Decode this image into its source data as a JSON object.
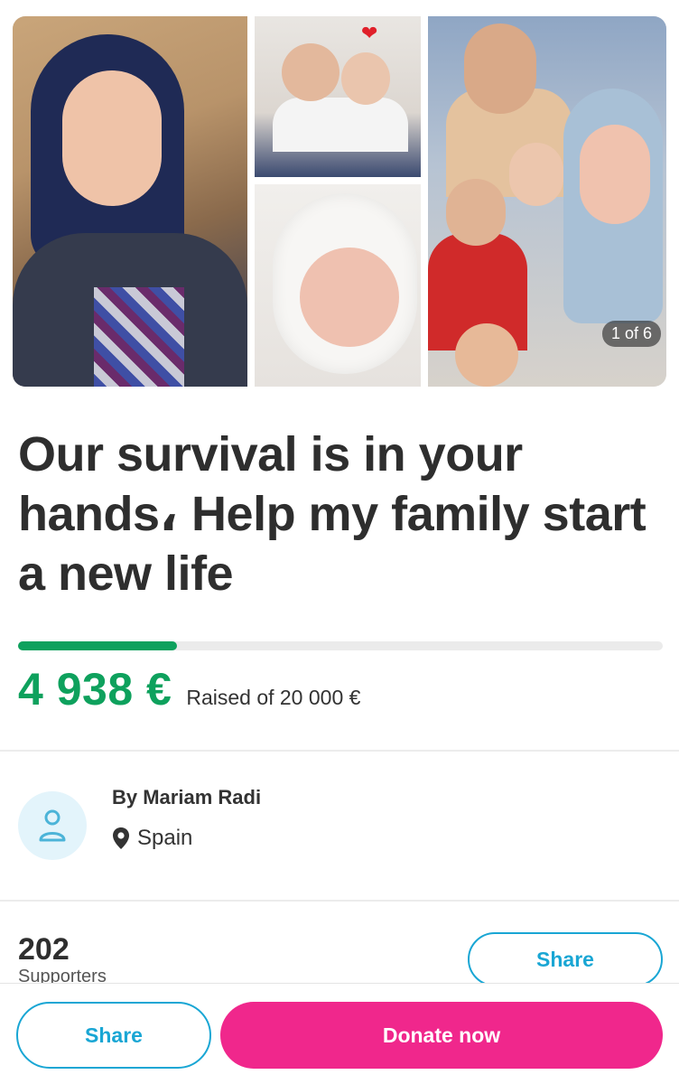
{
  "gallery": {
    "counter": "1 of 6",
    "icons": [
      "heart-icon"
    ]
  },
  "campaign": {
    "title": "Our survival is in your hands، Help my family start a new life"
  },
  "progress": {
    "fraction": 0.247,
    "raised": "4 938 €",
    "raised_label": "Raised of 20 000 €",
    "color": "#0ea15d"
  },
  "organizer": {
    "name": "By Mariam Radi",
    "location": "Spain",
    "icons": [
      "user-icon",
      "location-pin-icon"
    ]
  },
  "supporters": {
    "count": "202",
    "label": "Supporters"
  },
  "actions": {
    "share_label": "Share",
    "share_bottom_label": "Share",
    "donate_label": "Donate now",
    "share_color": "#19a6d4",
    "donate_color": "#f0278c"
  }
}
